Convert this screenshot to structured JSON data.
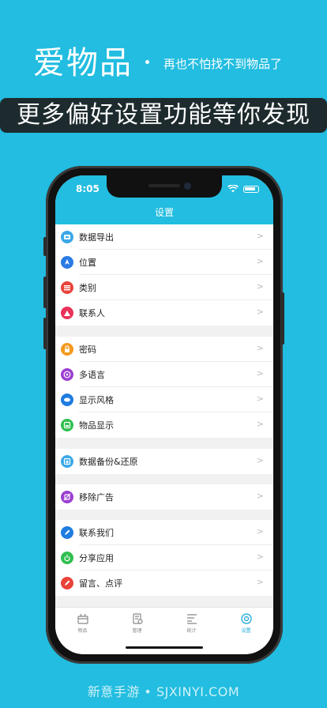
{
  "promo": {
    "brand": "爱物品",
    "slogan": "再也不怕找不到物品了",
    "headline": "更多偏好设置功能等你发现"
  },
  "status_bar": {
    "time": "8:05"
  },
  "nav": {
    "title": "设置"
  },
  "settings": {
    "items": [
      {
        "label": "数据导出",
        "icon": "export-icon",
        "color": "#3aa8e8"
      },
      {
        "label": "位置",
        "icon": "location-icon",
        "color": "#2a7be4"
      },
      {
        "label": "类别",
        "icon": "category-icon",
        "color": "#e9433a"
      },
      {
        "label": "联系人",
        "icon": "contacts-icon",
        "color": "#e9325a"
      },
      {
        "label": "密码",
        "icon": "lock-icon",
        "color": "#f39a1e"
      },
      {
        "label": "多语言",
        "icon": "language-icon",
        "color": "#9b3fd1"
      },
      {
        "label": "显示风格",
        "icon": "style-icon",
        "color": "#1f7ce0"
      },
      {
        "label": "物品显示",
        "icon": "item-display-icon",
        "color": "#2fbf4f"
      },
      {
        "label": "数据备份&还原",
        "icon": "backup-icon",
        "color": "#3aa8e8"
      },
      {
        "label": "移除广告",
        "icon": "remove-ads-icon",
        "color": "#9b3fd1"
      },
      {
        "label": "联系我们",
        "icon": "contact-us-icon",
        "color": "#1f7ce0"
      },
      {
        "label": "分享应用",
        "icon": "share-icon",
        "color": "#2fbf4f"
      },
      {
        "label": "留言、点评",
        "icon": "review-icon",
        "color": "#e9433a"
      }
    ]
  },
  "tabbar": {
    "items": [
      {
        "label": "物品",
        "icon": "box-icon"
      },
      {
        "label": "管理",
        "icon": "manage-icon"
      },
      {
        "label": "统计",
        "icon": "stats-icon"
      },
      {
        "label": "设置",
        "icon": "gear-icon",
        "active": true
      }
    ],
    "accent": "#1ba7d9"
  },
  "watermark": "新意手游 • SJXINYI.COM"
}
